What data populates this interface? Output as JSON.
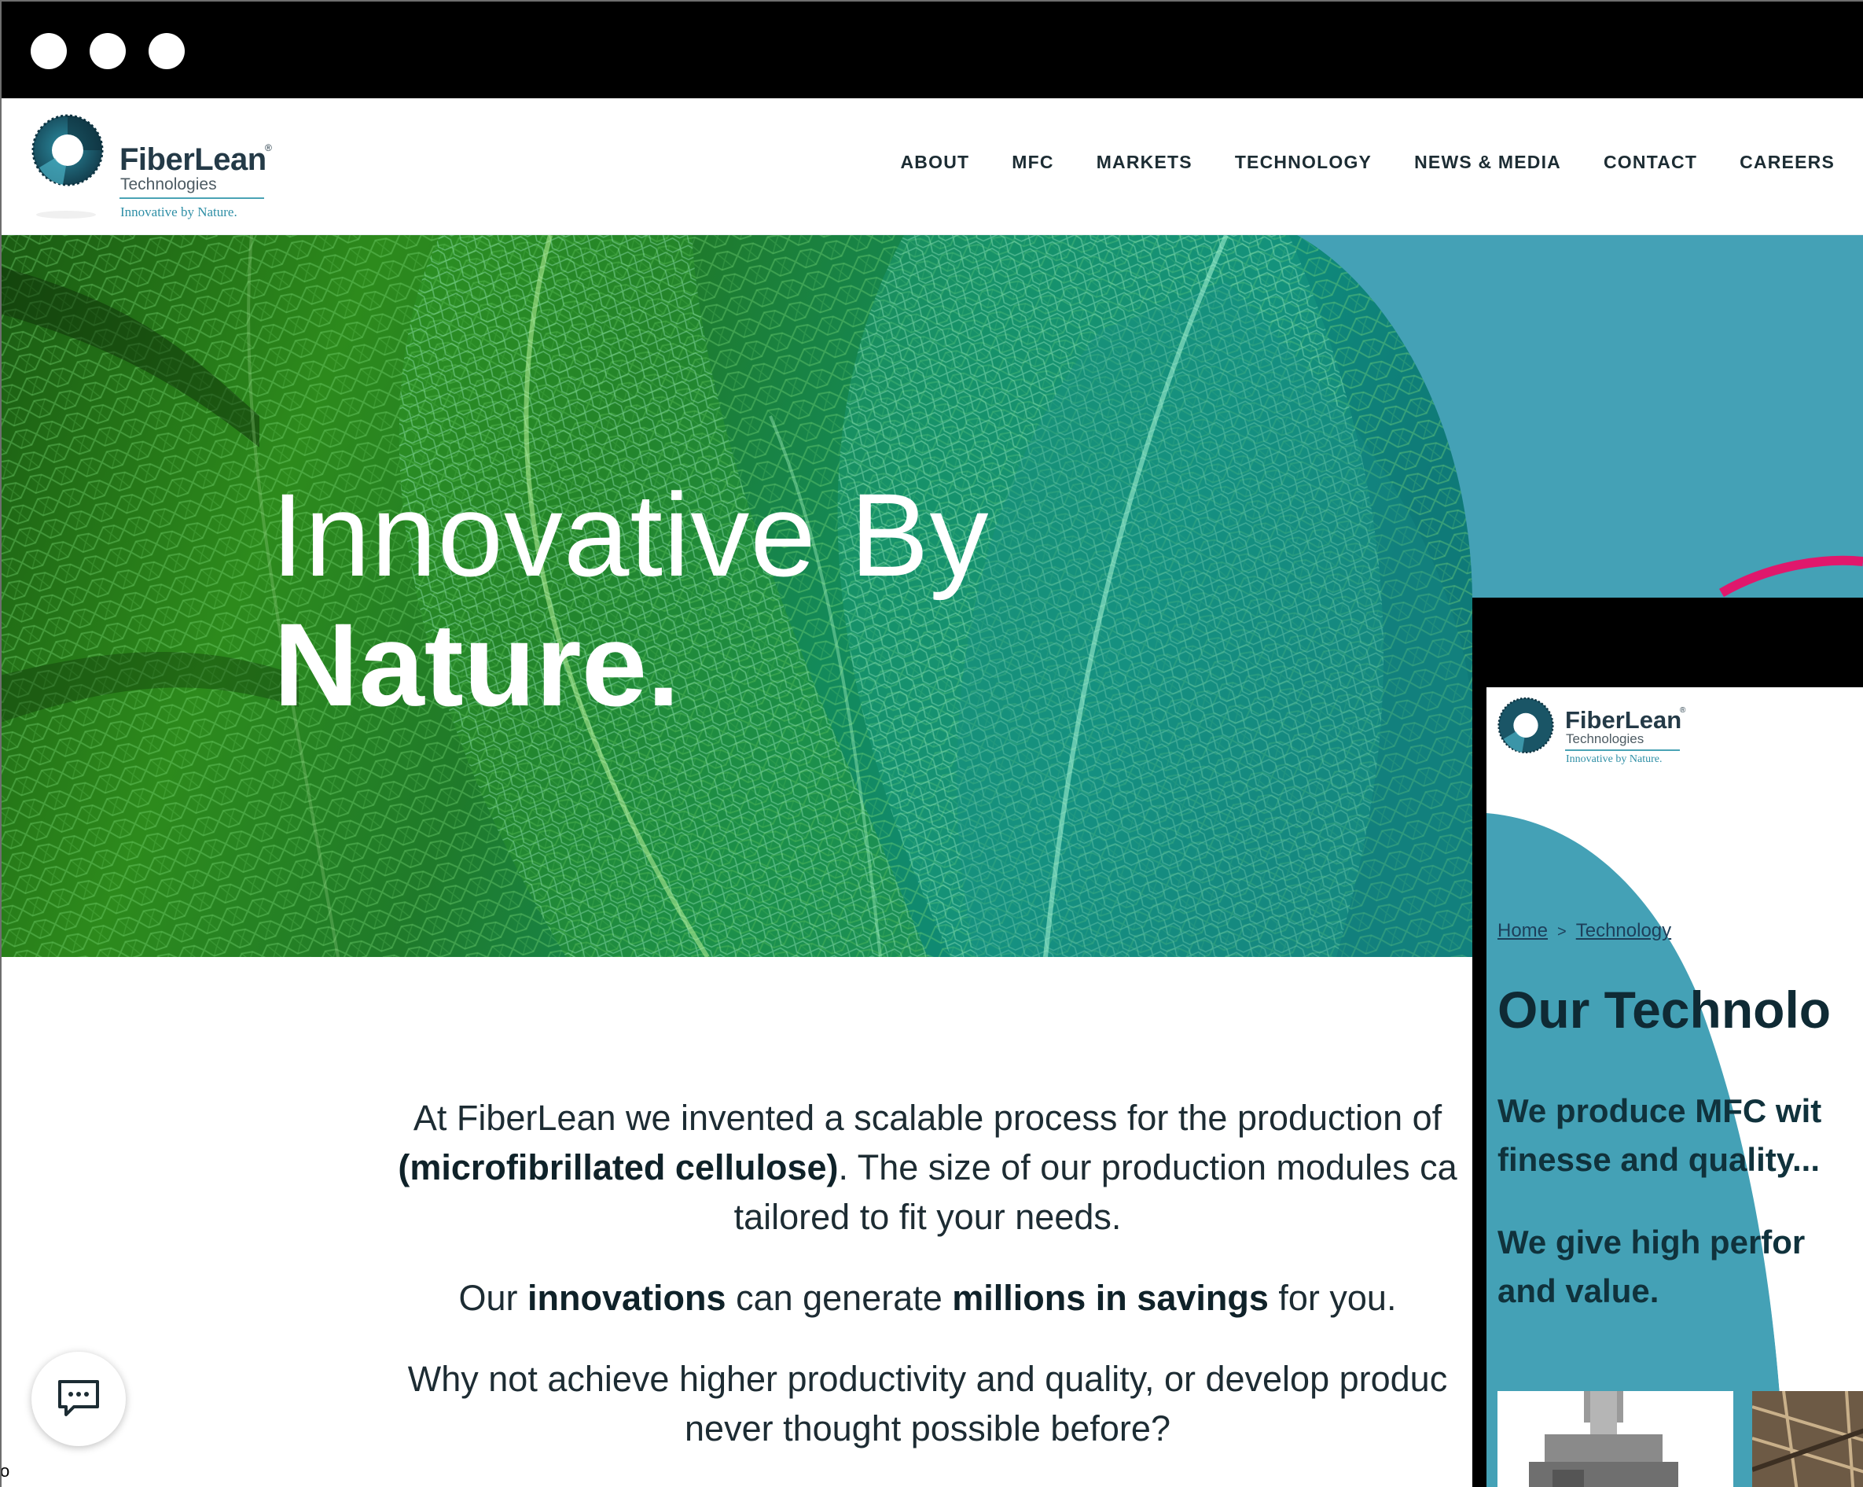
{
  "browser": {
    "window_buttons": [
      "close-dot",
      "minimize-dot",
      "maximize-dot"
    ]
  },
  "brand": {
    "name": "FiberLean",
    "registered": "®",
    "sub": "Technologies",
    "tagline": "Innovative by Nature."
  },
  "nav": {
    "items": [
      {
        "label": "ABOUT"
      },
      {
        "label": "MFC"
      },
      {
        "label": "MARKETS"
      },
      {
        "label": "TECHNOLOGY"
      },
      {
        "label": "NEWS & MEDIA"
      },
      {
        "label": "CONTACT"
      },
      {
        "label": "CAREERS"
      }
    ]
  },
  "hero": {
    "title_light": "Innovative By",
    "title_bold": "Nature."
  },
  "intro": {
    "p1_a": "At FiberLean we invented a scalable process for the production of",
    "p1_b": "(microfibrillated cellulose)",
    "p1_c": ". The size of our production modules ca",
    "p1_d": "tailored to fit your needs.",
    "p2_a": "Our ",
    "p2_b": "innovations",
    "p2_c": " can generate ",
    "p2_d": "millions in savings",
    "p2_e": " for you.",
    "p3_a": "Why not achieve higher productivity and quality, or develop produc",
    "p3_b": "never thought possible before?"
  },
  "chat": {
    "icon": "chat-bubble-icon"
  },
  "corner_glyph": "o",
  "mobile": {
    "brand": {
      "name": "FiberLean",
      "registered": "®",
      "sub": "Technologies",
      "tagline": "Innovative by Nature."
    },
    "breadcrumb": {
      "home": "Home",
      "separator": ">",
      "current": "Technology"
    },
    "title": "Our Technolo",
    "text1_a": "We produce MFC wit",
    "text1_b": "finesse and quality...",
    "text2_a": "We give high perfor",
    "text2_b": "and value."
  },
  "colors": {
    "teal": "#44a1b6",
    "dark_navy": "#0f2a34",
    "magenta_accent": "#e0186c"
  }
}
